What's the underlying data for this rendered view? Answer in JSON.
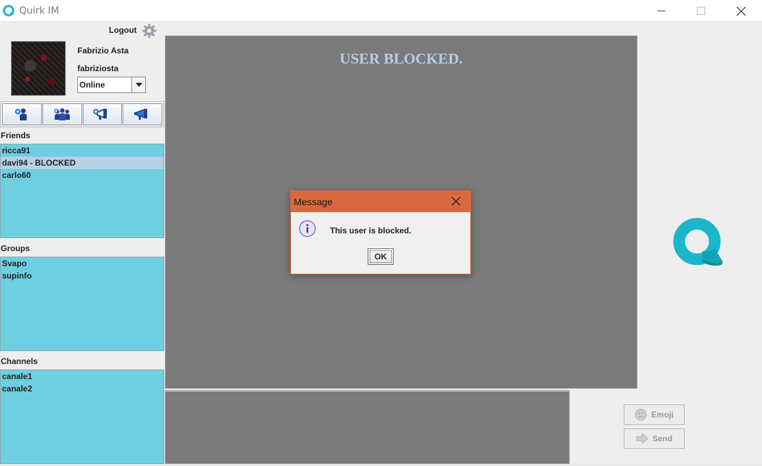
{
  "window": {
    "title": "Quirk IM"
  },
  "profile": {
    "logout_label": "Logout",
    "full_name": "Fabrizio Asta",
    "username": "fabriziosta",
    "status": "Online"
  },
  "sections": {
    "friends_label": "Friends",
    "groups_label": "Groups",
    "channels_label": "Channels"
  },
  "friends": [
    {
      "label": "ricca91"
    },
    {
      "label": "davi94 - BLOCKED"
    },
    {
      "label": "carlo60"
    }
  ],
  "groups": [
    {
      "label": "Svapo"
    },
    {
      "label": "supinfo"
    }
  ],
  "channels": [
    {
      "label": "canale1"
    },
    {
      "label": "canale2"
    }
  ],
  "chat": {
    "header": "USER BLOCKED."
  },
  "actions": {
    "emoji_label": "Emoji",
    "send_label": "Send"
  },
  "dialog": {
    "title": "Message",
    "message": "This user is blocked.",
    "ok_label": "OK"
  },
  "colors": {
    "list_bg": "#6ecfe0",
    "selected_row": "#b8cfe6",
    "dialog_title": "#d9693c",
    "chat_bg": "#7a7a7a",
    "header_text": "#b5cde6",
    "brand": "#1bb6c9"
  }
}
